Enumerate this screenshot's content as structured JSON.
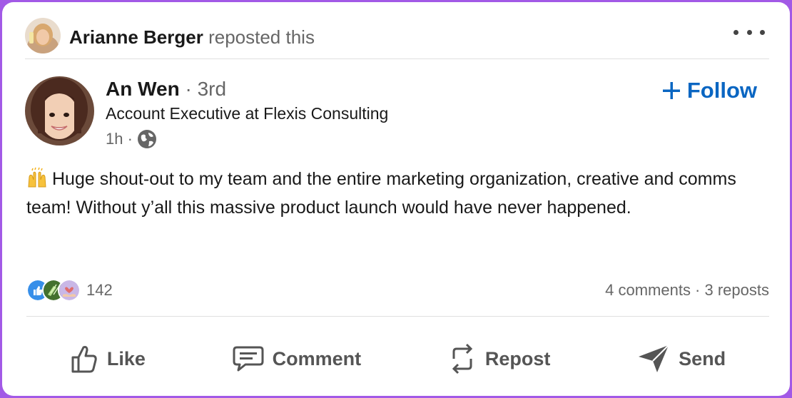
{
  "repost": {
    "name": "Arianne Berger",
    "verb": "reposted this"
  },
  "author": {
    "name": "An Wen",
    "degree": "· 3rd",
    "headline": "Account Executive at Flexis Consulting",
    "time": "1h ·",
    "visibility_icon": "globe-icon"
  },
  "follow": {
    "label": "Follow",
    "icon": "plus-icon"
  },
  "post": {
    "emoji_icon": "raised-hands-icon",
    "text": "Huge shout-out to my team and the entire marketing organization, creative and comms team! Without y’all this massive product launch would have never happened."
  },
  "social": {
    "reaction_icons": [
      "like-reaction-icon",
      "celebrate-reaction-icon",
      "support-reaction-icon"
    ],
    "reaction_count": "142",
    "engagement": "4 comments · 3 reposts"
  },
  "actions": {
    "like": "Like",
    "comment": "Comment",
    "repost": "Repost",
    "send": "Send"
  },
  "colors": {
    "accent": "#0a66c2",
    "frame": "#a259e6",
    "text_primary": "#191919",
    "text_secondary": "#666666"
  }
}
